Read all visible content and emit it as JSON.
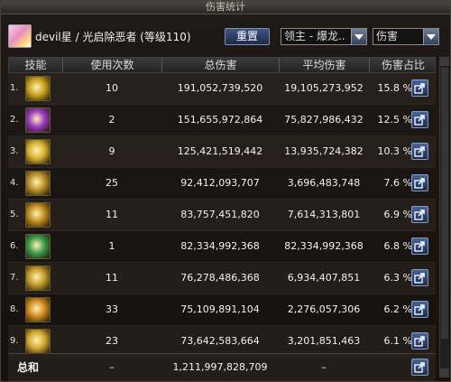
{
  "window": {
    "title": "伤害统计"
  },
  "player": {
    "label": "devil星 / 光启除恶者 (等级110)"
  },
  "controls": {
    "reset_label": "重置",
    "target_select": "领主 - 爆龙..",
    "stat_select": "伤害"
  },
  "columns": {
    "skill": "技能",
    "count": "使用次数",
    "total": "总伤害",
    "avg": "平均伤害",
    "pct": "伤害占比"
  },
  "rows": [
    {
      "rank": "1.",
      "icon": "golden-slash-skill-icon",
      "color": "#c9a020",
      "count": "10",
      "total": "191,052,739,520",
      "avg": "19,105,273,952",
      "pct": "15.8 %"
    },
    {
      "rank": "2.",
      "icon": "purple-burst-skill-icon",
      "color": "#9a3ac0",
      "count": "2",
      "total": "151,655,972,864",
      "avg": "75,827,986,432",
      "pct": "12.5 %"
    },
    {
      "rank": "3.",
      "icon": "light-spark-skill-icon",
      "color": "#d6b030",
      "count": "9",
      "total": "125,421,519,442",
      "avg": "13,935,724,382",
      "pct": "10.3 %"
    },
    {
      "rank": "4.",
      "icon": "ground-wave-skill-icon",
      "color": "#b8902a",
      "count": "25",
      "total": "92,412,093,707",
      "avg": "3,696,483,748",
      "pct": "7.6 %"
    },
    {
      "rank": "5.",
      "icon": "lightning-strike-skill-icon",
      "color": "#c08a20",
      "count": "11",
      "total": "83,757,451,820",
      "avg": "7,614,313,801",
      "pct": "6.9 %"
    },
    {
      "rank": "6.",
      "icon": "green-orb-skill-icon",
      "color": "#3a9a4a",
      "count": "1",
      "total": "82,334,992,368",
      "avg": "82,334,992,368",
      "pct": "6.8 %"
    },
    {
      "rank": "7.",
      "icon": "holy-crown-skill-icon",
      "color": "#c49a2a",
      "count": "11",
      "total": "76,278,486,368",
      "avg": "6,934,407,851",
      "pct": "6.3 %"
    },
    {
      "rank": "8.",
      "icon": "flame-pillar-skill-icon",
      "color": "#d08a20",
      "count": "33",
      "total": "75,109,891,104",
      "avg": "2,276,057,306",
      "pct": "6.2 %"
    },
    {
      "rank": "9.",
      "icon": "crescent-slash-skill-icon",
      "color": "#d4a830",
      "count": "23",
      "total": "73,642,583,664",
      "avg": "3,201,851,463",
      "pct": "6.1 %"
    }
  ],
  "summary": {
    "label": "总和",
    "count": "–",
    "total": "1,211,997,828,709",
    "avg": "–"
  }
}
